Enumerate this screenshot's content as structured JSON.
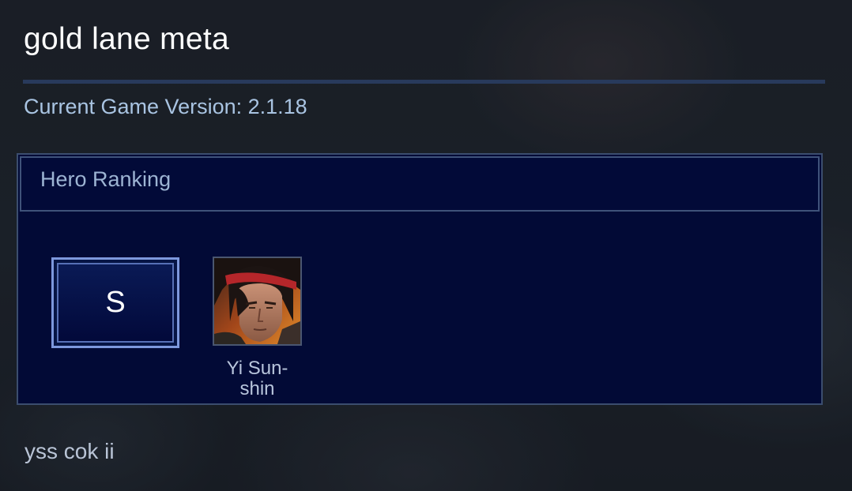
{
  "page": {
    "title": "gold lane meta",
    "version_line": "Current Game Version: 2.1.18",
    "footer_note": "yss cok ii"
  },
  "ranking": {
    "header_label": "Hero Ranking",
    "tiers": [
      {
        "tier": "S",
        "heroes": [
          {
            "name": "Yi Sun-shin",
            "portrait_icon": "hero-portrait-yi-sun-shin"
          }
        ]
      }
    ]
  },
  "colors": {
    "panel_bg": "#020a36",
    "panel_border": "#3b4d6e",
    "tier_border": "#7d98dd",
    "divider": "#283a5c",
    "version_text": "#a9c4e2"
  }
}
